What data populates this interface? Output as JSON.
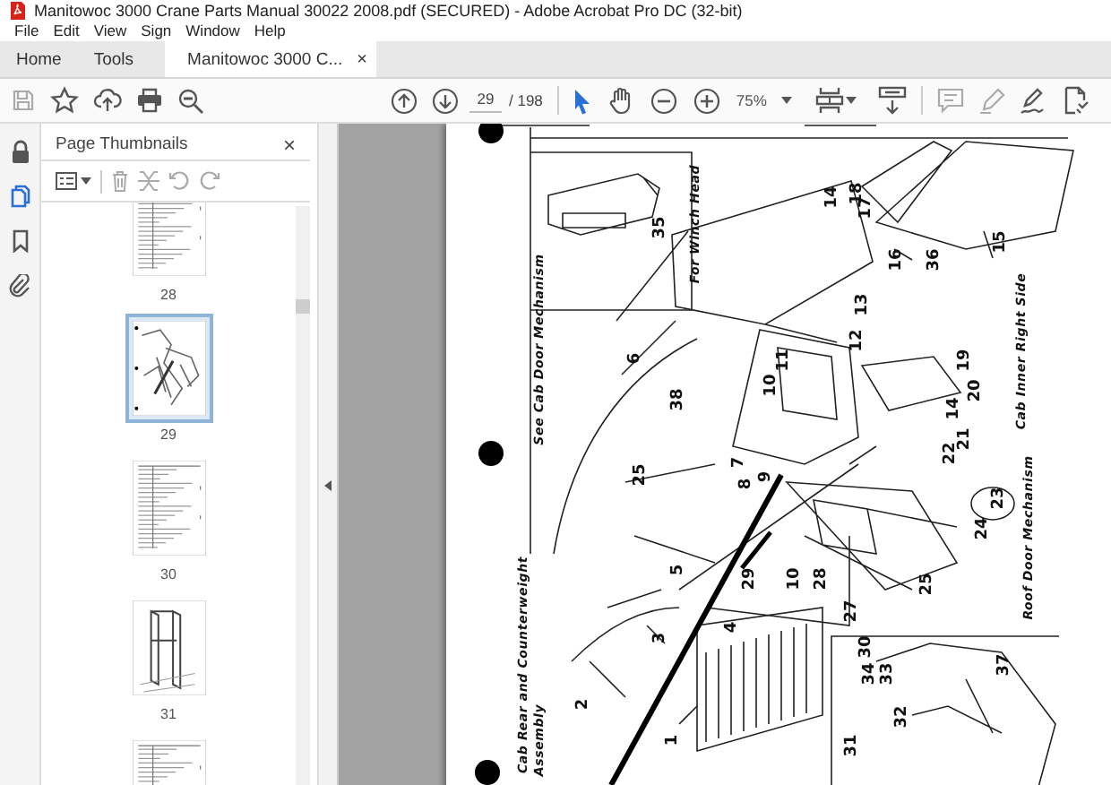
{
  "window": {
    "title": "Manitowoc 3000 Crane Parts Manual 30022 2008.pdf (SECURED) - Adobe Acrobat Pro DC (32-bit)"
  },
  "menu": [
    "File",
    "Edit",
    "View",
    "Sign",
    "Window",
    "Help"
  ],
  "tabs": [
    {
      "label": "Home",
      "selected": false
    },
    {
      "label": "Tools",
      "selected": false
    },
    {
      "label": "Manitowoc 3000 C...",
      "selected": true,
      "close": "×"
    }
  ],
  "toolbar": {
    "page_number": "29",
    "page_total": "/ 198",
    "zoom": "75%"
  },
  "side_rail": [
    {
      "kind": "lock",
      "selected": false
    },
    {
      "kind": "pages",
      "selected": true
    },
    {
      "kind": "bookmark",
      "selected": false
    },
    {
      "kind": "attachment",
      "selected": false
    }
  ],
  "thumbnails_panel": {
    "title": "Page Thumbnails",
    "close": "×",
    "pages": [
      {
        "kind": "table",
        "label": "28",
        "selected": false
      },
      {
        "kind": "diagram",
        "label": "29",
        "selected": true
      },
      {
        "kind": "table",
        "label": "30",
        "selected": false
      },
      {
        "kind": "frame",
        "label": "31",
        "selected": false
      },
      {
        "kind": "table",
        "selected": false
      }
    ]
  },
  "document": {
    "captions": [
      "For Winch Head",
      "See Cab Door Mechanism",
      "Cab Inner Right Side",
      "Roof Door Mechanism",
      "Cab Rear and Counterweight",
      "Assembly"
    ],
    "callouts": [
      "35",
      "14",
      "18",
      "17",
      "16",
      "36",
      "15",
      "13",
      "12",
      "11",
      "10",
      "19",
      "20",
      "14",
      "21",
      "6",
      "38",
      "22",
      "7",
      "8",
      "9",
      "25",
      "23",
      "24",
      "5",
      "29",
      "10",
      "28",
      "25",
      "27",
      "4",
      "3",
      "2",
      "1",
      "30",
      "34",
      "33",
      "37",
      "32",
      "31"
    ]
  }
}
